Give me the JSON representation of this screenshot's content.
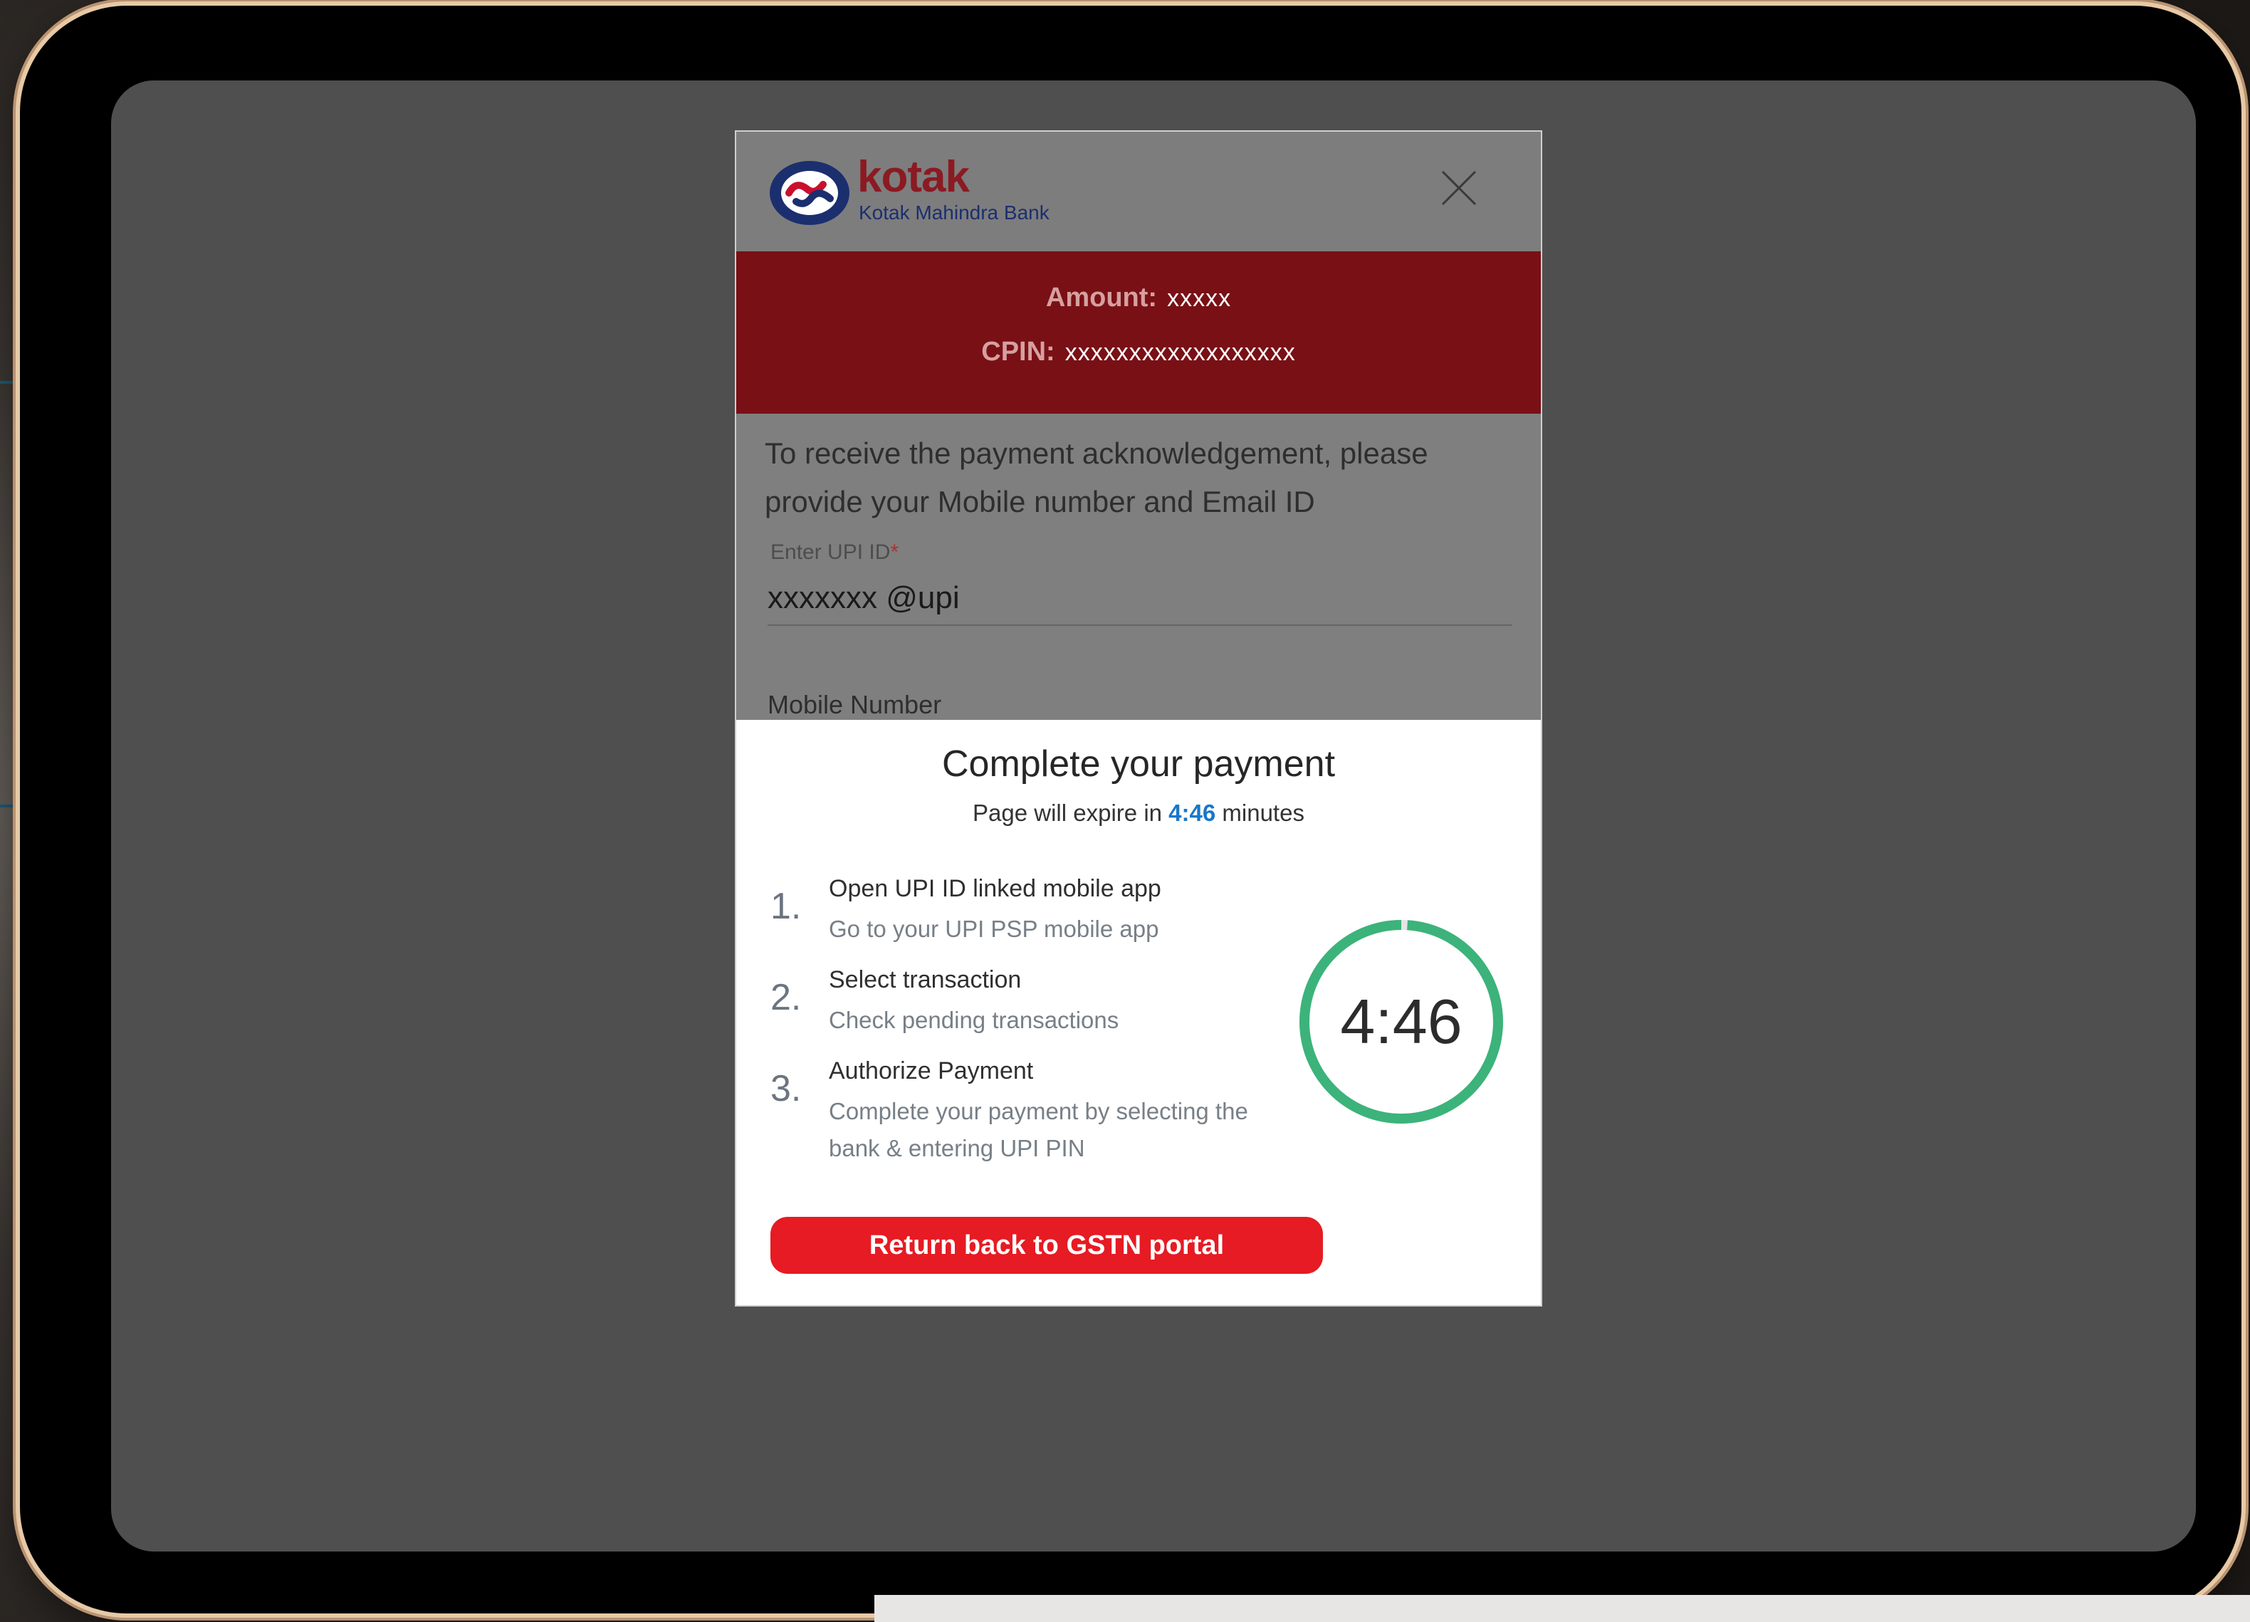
{
  "bank": {
    "name": "kotak",
    "full_name": "Kotak Mahindra Bank",
    "brand_color": "#8b1a22",
    "navy_color": "#1b2f6e"
  },
  "header": {
    "close_icon": "close-icon"
  },
  "amount_band": {
    "amount_label": "Amount:",
    "amount_value": "xxxxx",
    "cpin_label": "CPIN:",
    "cpin_value": "xxxxxxxxxxxxxxxxxx",
    "color": "#791015"
  },
  "form": {
    "intro": "To receive the payment acknowledgement, please provide your Mobile number and Email ID",
    "upi_label": "Enter UPI ID",
    "upi_required": "*",
    "upi_value": "xxxxxxx @upi",
    "mobile_label": "Mobile Number"
  },
  "payment": {
    "title": "Complete your payment",
    "expire_prefix": "Page will expire in",
    "expire_time": "4:46",
    "expire_suffix": "minutes",
    "steps": [
      {
        "num": "1.",
        "title": "Open UPI ID linked mobile app",
        "desc": "Go to your UPI PSP mobile app"
      },
      {
        "num": "2.",
        "title": "Select transaction",
        "desc": "Check pending transactions"
      },
      {
        "num": "3.",
        "title": "Authorize Payment",
        "desc": "Complete your payment by selecting the bank & entering UPI PIN"
      }
    ],
    "timer_text": "4:46",
    "timer_progress": 0.99,
    "timer_color": "#3cb37a",
    "button_label": "Return back to GSTN portal",
    "button_color": "#e61b23"
  }
}
